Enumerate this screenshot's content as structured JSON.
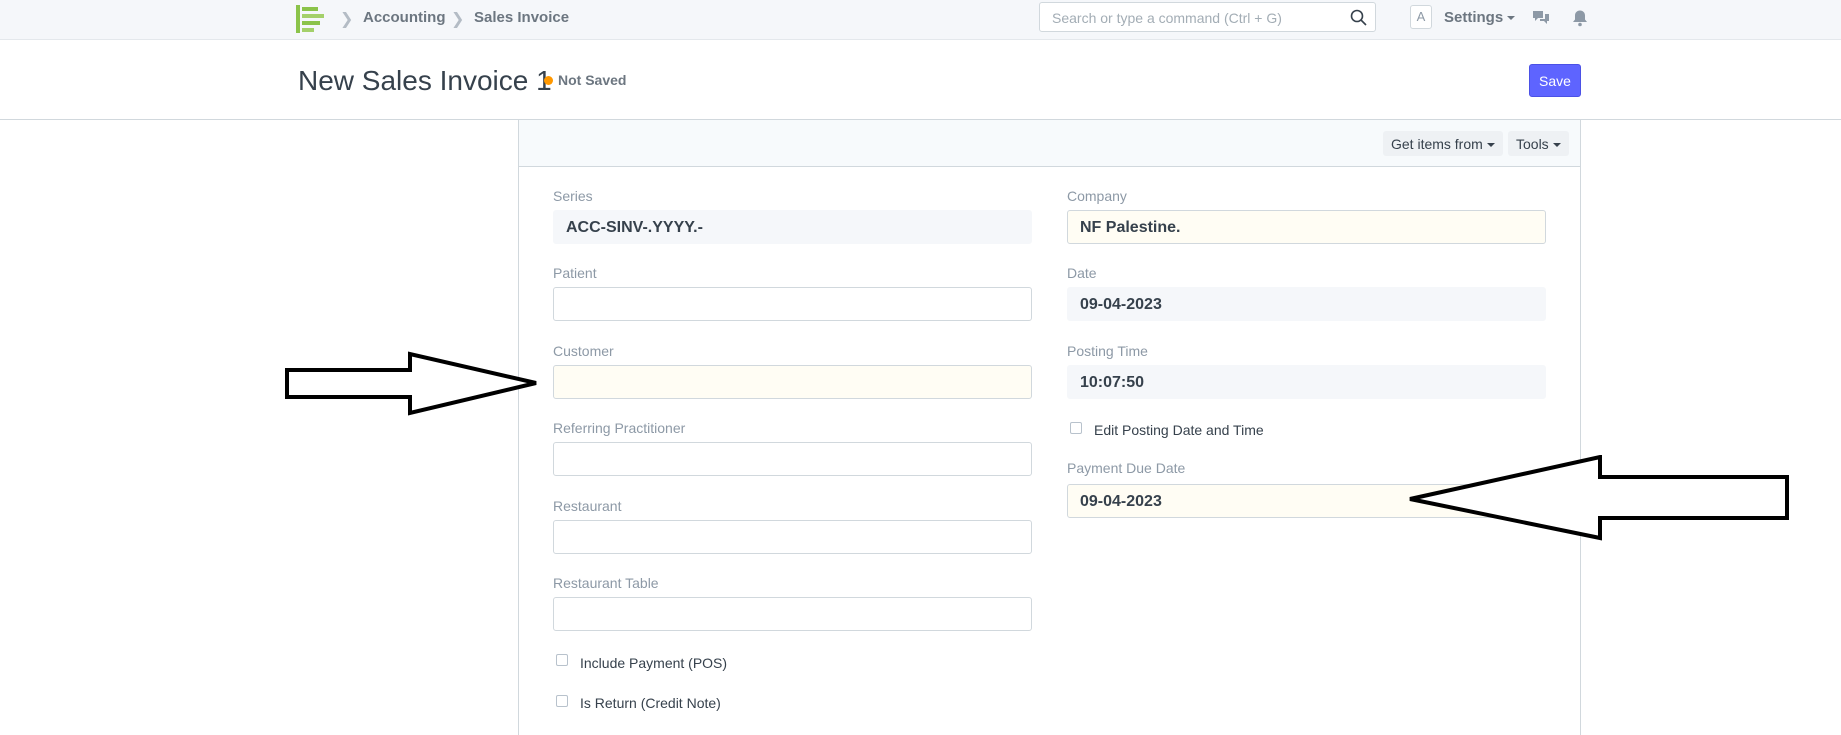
{
  "navbar": {
    "breadcrumbs": [
      "Accounting",
      "Sales Invoice"
    ],
    "search_placeholder": "Search or type a command (Ctrl + G)",
    "avatar_letter": "A",
    "settings_label": "Settings",
    "logo_color": "#8bc34a"
  },
  "page": {
    "title": "New Sales Invoice 1",
    "status": "Not Saved",
    "status_color": "#ff9800",
    "save_label": "Save",
    "primary_color": "#5e64ff"
  },
  "toolbar": {
    "get_items_label": "Get items from",
    "tools_label": "Tools"
  },
  "form": {
    "left": {
      "series": {
        "label": "Series",
        "value": "ACC-SINV-.YYYY.-"
      },
      "patient": {
        "label": "Patient",
        "value": ""
      },
      "customer": {
        "label": "Customer",
        "value": ""
      },
      "referring_practitioner": {
        "label": "Referring Practitioner",
        "value": ""
      },
      "restaurant": {
        "label": "Restaurant",
        "value": ""
      },
      "restaurant_table": {
        "label": "Restaurant Table",
        "value": ""
      },
      "include_payment": {
        "label": "Include Payment (POS)",
        "checked": false
      },
      "is_return": {
        "label": "Is Return (Credit Note)",
        "checked": false
      }
    },
    "right": {
      "company": {
        "label": "Company",
        "value": "NF Palestine."
      },
      "date": {
        "label": "Date",
        "value": "09-04-2023"
      },
      "posting_time": {
        "label": "Posting Time",
        "value": "10:07:50"
      },
      "edit_posting": {
        "label": "Edit Posting Date and Time",
        "checked": false
      },
      "payment_due_date": {
        "label": "Payment Due Date",
        "value": "09-04-2023"
      }
    }
  }
}
